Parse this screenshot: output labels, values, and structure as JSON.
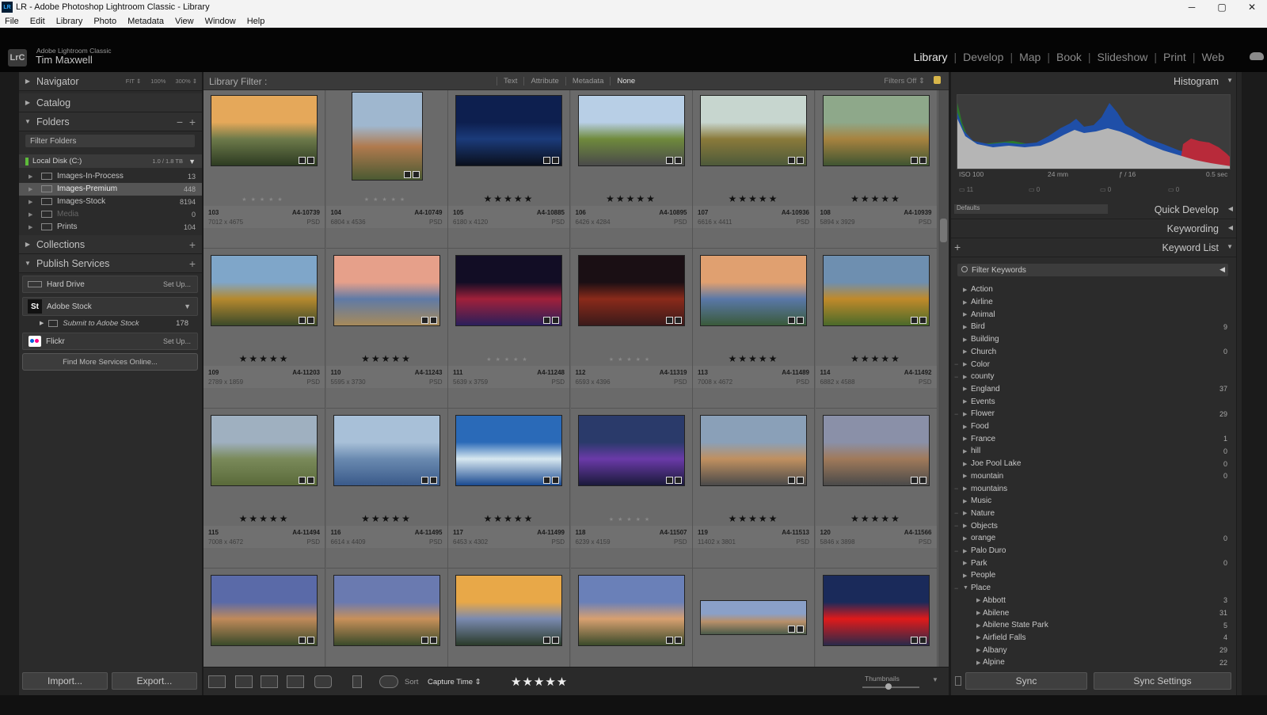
{
  "window": {
    "icon": "LR",
    "title": "LR - Adobe Photoshop Lightroom Classic - Library",
    "controls": [
      "─",
      "▢",
      "✕"
    ]
  },
  "menu": [
    "File",
    "Edit",
    "Library",
    "Photo",
    "Metadata",
    "View",
    "Window",
    "Help"
  ],
  "identity": {
    "badge": "LrC",
    "app": "Adobe Lightroom Classic",
    "user": "Tim Maxwell"
  },
  "modules": [
    "Library",
    "Develop",
    "Map",
    "Book",
    "Slideshow",
    "Print",
    "Web"
  ],
  "active_module": "Library",
  "left_panel": {
    "navigator": {
      "title": "Navigator",
      "options": [
        "FIT ⇕",
        "100%",
        "300% ⇕"
      ]
    },
    "catalog": {
      "title": "Catalog"
    },
    "folders": {
      "title": "Folders",
      "filter_placeholder": "Filter Folders",
      "disk": {
        "name": "Local Disk (C:)",
        "capacity": "1.0 / 1.8 TB"
      },
      "items": [
        {
          "name": "Images-In-Process",
          "count": "13"
        },
        {
          "name": "Images-Premium",
          "count": "448"
        },
        {
          "name": "Images-Stock",
          "count": "8194"
        },
        {
          "name": "Media",
          "count": "0"
        },
        {
          "name": "Prints",
          "count": "104"
        }
      ]
    },
    "collections": {
      "title": "Collections"
    },
    "publish": {
      "title": "Publish Services",
      "hard_drive": {
        "label": "Hard Drive",
        "action": "Set Up..."
      },
      "adobe_stock": {
        "icon": "St",
        "label": "Adobe Stock"
      },
      "submit": {
        "label": "Submit to Adobe Stock",
        "count": "178"
      },
      "flickr": {
        "label": "Flickr",
        "action": "Set Up..."
      },
      "find_more": "Find More Services Online..."
    },
    "import_label": "Import...",
    "export_label": "Export..."
  },
  "filter_bar": {
    "label": "Library Filter :",
    "tabs": [
      "Text",
      "Attribute",
      "Metadata",
      "None"
    ],
    "active": "None",
    "status": "Filters Off ⇕"
  },
  "grid": {
    "rows": [
      [
        {
          "idx": "103",
          "code": "A4-10739",
          "dims": "7012 x 4675",
          "ext": "PSD",
          "stars": "★★★★★",
          "rated": false,
          "colors": [
            "#e5a85a",
            "#6d7a4a",
            "#2d3b22"
          ],
          "portrait": false
        },
        {
          "idx": "104",
          "code": "A4-10749",
          "dims": "6804 x 4536",
          "ext": "PSD",
          "stars": "★★★★★",
          "rated": false,
          "colors": [
            "#9fb7cf",
            "#b07a4e",
            "#4b5a32"
          ],
          "portrait": true
        },
        {
          "idx": "105",
          "code": "A4-10885",
          "dims": "6180 x 4120",
          "ext": "PSD",
          "stars": "★★★★★",
          "rated": true,
          "colors": [
            "#0d1f4f",
            "#1b3b7a",
            "#0a0f1c"
          ],
          "portrait": false
        },
        {
          "idx": "106",
          "code": "A4-10895",
          "dims": "6426 x 4284",
          "ext": "PSD",
          "stars": "★★★★★",
          "rated": true,
          "colors": [
            "#b8cfe6",
            "#6f8a3c",
            "#4a4a4a"
          ],
          "portrait": false
        },
        {
          "idx": "107",
          "code": "A4-10936",
          "dims": "6616 x 4411",
          "ext": "PSD",
          "stars": "★★★★★",
          "rated": true,
          "colors": [
            "#c7d6cf",
            "#8a7a3a",
            "#4d5a3a"
          ],
          "portrait": false
        },
        {
          "idx": "108",
          "code": "A4-10939",
          "dims": "5894 x 3929",
          "ext": "PSD",
          "stars": "★★★★★",
          "rated": true,
          "colors": [
            "#8ea88a",
            "#a7833f",
            "#3f5532"
          ],
          "portrait": false
        }
      ],
      [
        {
          "idx": "109",
          "code": "A4-11203",
          "dims": "2789 x 1859",
          "ext": "PSD",
          "stars": "★★★★★",
          "rated": true,
          "colors": [
            "#7fa6c9",
            "#b5892e",
            "#3c4a2a"
          ],
          "portrait": false
        },
        {
          "idx": "110",
          "code": "A4-11243",
          "dims": "5595 x 3730",
          "ext": "PSD",
          "stars": "★★★★★",
          "rated": true,
          "colors": [
            "#e6a08a",
            "#5f7aa6",
            "#a78a5a"
          ],
          "portrait": false
        },
        {
          "idx": "111",
          "code": "A4-11248",
          "dims": "5639 x 3759",
          "ext": "PSD",
          "stars": "★★★★★",
          "rated": false,
          "colors": [
            "#120d25",
            "#a0203a",
            "#2a1f5a"
          ],
          "portrait": false
        },
        {
          "idx": "112",
          "code": "A4-11319",
          "dims": "6593 x 4396",
          "ext": "PSD",
          "stars": "★★★★★",
          "rated": false,
          "colors": [
            "#1a0f14",
            "#8a2a1a",
            "#3a1a1a"
          ],
          "portrait": false
        },
        {
          "idx": "113",
          "code": "A4-11489",
          "dims": "7008 x 4672",
          "ext": "PSD",
          "stars": "★★★★★",
          "rated": true,
          "colors": [
            "#e0a070",
            "#5a78a8",
            "#3a5a3a"
          ],
          "portrait": false
        },
        {
          "idx": "114",
          "code": "A4-11492",
          "dims": "6882 x 4588",
          "ext": "PSD",
          "stars": "★★★★★",
          "rated": true,
          "colors": [
            "#6e8fb0",
            "#c08a2a",
            "#4a6a2a"
          ],
          "portrait": false
        }
      ],
      [
        {
          "idx": "115",
          "code": "A4-11494",
          "dims": "7008 x 4672",
          "ext": "PSD",
          "stars": "★★★★★",
          "rated": true,
          "colors": [
            "#9fb0c0",
            "#7a8a5a",
            "#5a6a3a"
          ],
          "portrait": false
        },
        {
          "idx": "116",
          "code": "A4-11495",
          "dims": "6614 x 4409",
          "ext": "PSD",
          "stars": "★★★★★",
          "rated": true,
          "colors": [
            "#a8c0d8",
            "#6a8ab0",
            "#3a5a8a"
          ],
          "portrait": false
        },
        {
          "idx": "117",
          "code": "A4-11499",
          "dims": "6453 x 4302",
          "ext": "PSD",
          "stars": "★★★★★",
          "rated": true,
          "colors": [
            "#2a6ab8",
            "#d8e8f0",
            "#1a4a90"
          ],
          "portrait": false
        },
        {
          "idx": "118",
          "code": "A4-11507",
          "dims": "6239 x 4159",
          "ext": "PSD",
          "stars": "★★★★★",
          "rated": false,
          "colors": [
            "#2a3a6a",
            "#6a3aa8",
            "#1a1a3a"
          ],
          "portrait": false
        },
        {
          "idx": "119",
          "code": "A4-11513",
          "dims": "11402 x 3801",
          "ext": "PSD",
          "stars": "★★★★★",
          "rated": true,
          "colors": [
            "#8aa0b8",
            "#c09060",
            "#4a4a4a"
          ],
          "portrait": false
        },
        {
          "idx": "120",
          "code": "A4-11566",
          "dims": "5846 x 3898",
          "ext": "PSD",
          "stars": "★★★★★",
          "rated": true,
          "colors": [
            "#8a90a8",
            "#a07a5a",
            "#4a4a4a"
          ],
          "portrait": false
        }
      ],
      [
        {
          "colors": [
            "#5a6aa8",
            "#c08a5a",
            "#3a4a2a"
          ],
          "portrait": false
        },
        {
          "colors": [
            "#6a7ab0",
            "#c8905a",
            "#3a4a2a"
          ],
          "portrait": false
        },
        {
          "colors": [
            "#e8a848",
            "#7a8ab0",
            "#2a3a2a"
          ],
          "portrait": false
        },
        {
          "colors": [
            "#6a80b8",
            "#d8a070",
            "#3a4a2a"
          ],
          "portrait": false
        },
        {
          "colors": [
            "#8aa0c8",
            "#b8906a",
            "#4a5a4a"
          ],
          "portrait": false,
          "pano": true
        },
        {
          "colors": [
            "#1a2a5a",
            "#e01a1a",
            "#2a2a4a"
          ],
          "portrait": false
        }
      ]
    ]
  },
  "toolbar": {
    "sort_label": "Sort",
    "sort_value": "Capture Time ⇕",
    "stars": "★★★★★",
    "thumbs_label": "Thumbnails"
  },
  "right_panel": {
    "histogram": {
      "title": "Histogram",
      "exif": {
        "iso": "ISO 100",
        "focal": "24 mm",
        "aperture": "ƒ / 16",
        "shutter": "0.5 sec"
      },
      "toggle_values": [
        "11",
        "0",
        "0",
        "0"
      ]
    },
    "quick_develop": {
      "title": "Quick Develop",
      "preset": "Defaults"
    },
    "keywording": {
      "title": "Keywording"
    },
    "keyword_list": {
      "title": "Keyword List",
      "filter_placeholder": "Filter Keywords",
      "items": [
        {
          "name": "Action",
          "count": "",
          "indent": 0,
          "dash": false
        },
        {
          "name": "Airline",
          "count": "",
          "indent": 0,
          "dash": false
        },
        {
          "name": "Animal",
          "count": "",
          "indent": 0,
          "dash": false
        },
        {
          "name": "Bird",
          "count": "9",
          "indent": 0,
          "dash": false
        },
        {
          "name": "Building",
          "count": "",
          "indent": 0,
          "dash": false
        },
        {
          "name": "Church",
          "count": "0",
          "indent": 0,
          "dash": false
        },
        {
          "name": "Color",
          "count": "",
          "indent": 0,
          "dash": true
        },
        {
          "name": "county",
          "count": "",
          "indent": 0,
          "dash": true
        },
        {
          "name": "England",
          "count": "37",
          "indent": 0,
          "dash": false
        },
        {
          "name": "Events",
          "count": "",
          "indent": 0,
          "dash": false
        },
        {
          "name": "Flower",
          "count": "29",
          "indent": 0,
          "dash": true
        },
        {
          "name": "Food",
          "count": "",
          "indent": 0,
          "dash": false
        },
        {
          "name": "France",
          "count": "1",
          "indent": 0,
          "dash": false
        },
        {
          "name": "hill",
          "count": "0",
          "indent": 0,
          "dash": false
        },
        {
          "name": "Joe Pool Lake",
          "count": "0",
          "indent": 0,
          "dash": false
        },
        {
          "name": "mountain",
          "count": "0",
          "indent": 0,
          "dash": false
        },
        {
          "name": "mountains",
          "count": "",
          "indent": 0,
          "dash": true
        },
        {
          "name": "Music",
          "count": "",
          "indent": 0,
          "dash": false
        },
        {
          "name": "Nature",
          "count": "",
          "indent": 0,
          "dash": true
        },
        {
          "name": "Objects",
          "count": "",
          "indent": 0,
          "dash": true
        },
        {
          "name": "orange",
          "count": "0",
          "indent": 0,
          "dash": false
        },
        {
          "name": "Palo Duro",
          "count": "",
          "indent": 0,
          "dash": true
        },
        {
          "name": "Park",
          "count": "0",
          "indent": 0,
          "dash": false
        },
        {
          "name": "People",
          "count": "",
          "indent": 0,
          "dash": false
        },
        {
          "name": "Place",
          "count": "",
          "indent": 0,
          "dash": true,
          "open": true
        },
        {
          "name": "Abbott",
          "count": "3",
          "indent": 1,
          "dash": false
        },
        {
          "name": "Abilene",
          "count": "31",
          "indent": 1,
          "dash": false
        },
        {
          "name": "Abilene State Park",
          "count": "5",
          "indent": 1,
          "dash": false
        },
        {
          "name": "Airfield Falls",
          "count": "4",
          "indent": 1,
          "dash": false
        },
        {
          "name": "Albany",
          "count": "29",
          "indent": 1,
          "dash": false
        },
        {
          "name": "Alpine",
          "count": "22",
          "indent": 1,
          "dash": false
        }
      ]
    },
    "sync_label": "Sync",
    "sync_settings_label": "Sync Settings"
  }
}
